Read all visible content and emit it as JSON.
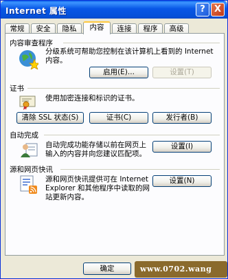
{
  "window": {
    "title": "Internet 属性"
  },
  "titlebar_buttons": {
    "help": "?",
    "close": "X"
  },
  "tabs": [
    "常规",
    "安全",
    "隐私",
    "内容",
    "连接",
    "程序",
    "高级"
  ],
  "active_tab": "内容",
  "content_advisor": {
    "title": "内容审查程序",
    "description": "分级系统可帮助您控制在该计算机上看到的 Internet 内容。",
    "enable_button": "启用(E)...",
    "settings_button": "设置(T)"
  },
  "certificates": {
    "title": "证书",
    "description": "使用加密连接和标识的证书。",
    "clear_ssl_button": "清除 SSL 状态(S)",
    "certificates_button": "证书(C)",
    "publishers_button": "发行者(B)"
  },
  "autocomplete": {
    "title": "自动完成",
    "description": "自动完成功能存储以前在网页上输入的内容并向您建议匹配项。",
    "settings_button": "设置(I)"
  },
  "feeds": {
    "title": "源和网页快讯",
    "description": "源和网页快讯提供可在 Internet Explorer 和其他程序中读取的网站更新内容。",
    "settings_button": "设置(N)"
  },
  "footer": {
    "ok_button": "确定",
    "watermark": "www.0702.wang"
  },
  "colors": {
    "titlebar": "#0857E6",
    "dialog_bg": "#ECE9D8",
    "active_tab_highlight": "#FFC83C"
  }
}
